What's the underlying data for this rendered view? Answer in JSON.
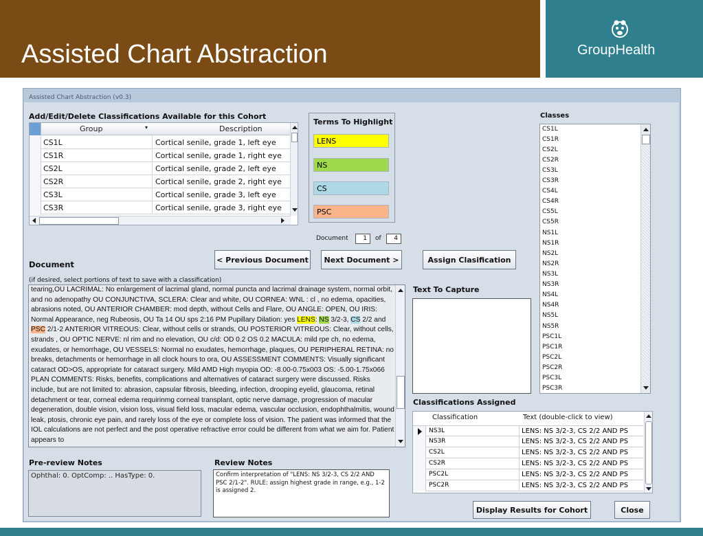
{
  "slide": {
    "title": "Assisted Chart Abstraction",
    "brand": "GroupHealth",
    "colors": {
      "banner": "#7b4b16",
      "brand": "#2f7f8e"
    }
  },
  "window": {
    "title": "Assisted Chart Abstraction (v0.3)"
  },
  "classifications_panel": {
    "heading": "Add/Edit/Delete Classifications Available for this Cohort",
    "columns": [
      "Group",
      "Description"
    ],
    "rows": [
      {
        "group": "CS1L",
        "description": "Cortical senile, grade 1, left eye"
      },
      {
        "group": "CS1R",
        "description": "Cortical senile, grade 1, right eye"
      },
      {
        "group": "CS2L",
        "description": "Cortical senile, grade 2, left eye"
      },
      {
        "group": "CS2R",
        "description": "Cortical senile, grade 2, right eye"
      },
      {
        "group": "CS3L",
        "description": "Cortical senile, grade 3, left eye"
      },
      {
        "group": "CS3R",
        "description": "Cortical senile, grade 3, right eye"
      }
    ]
  },
  "terms": {
    "heading": "Terms To Highlight",
    "items": [
      {
        "label": "LENS",
        "color": "#ffff00"
      },
      {
        "label": "NS",
        "color": "#a1d94c"
      },
      {
        "label": "CS",
        "color": "#add8e6"
      },
      {
        "label": "PSC",
        "color": "#f9b48a"
      }
    ]
  },
  "document_nav": {
    "label": "Document",
    "current": "1",
    "of_label": "of",
    "total": "4",
    "prev_button": "< Previous Document",
    "next_button": "Next Document >",
    "assign_button": "Assign Clasification"
  },
  "document": {
    "heading": "Document",
    "hint": "(if desired, select portions of text to save with a classification)",
    "text": {
      "p1": "tearing,OU  LACRIMAL: No enlargement of lacrimal gland, normal puncta and lacrimal drainage system, normal orbit, and no adenopathy OU  CONJUNCTIVA, SCLERA: Clear and white, OU  CORNEA: WNL : cl , no edema, opacities, abrasions noted, OU  ANTERIOR CHAMBER: mod depth, without Cells and Flare, OU  ANGLE: OPEN, OU  IRIS: Normal Appearance, neg Rubeosis, OU   Ta 14 OU sps 2:16 PM Pupillary Dilation: yes    ",
      "lens": "LENS",
      "p2": ": ",
      "ns": "NS",
      "p3": " 3/2-3, ",
      "cs": "CS",
      "p4": " 2/2 and ",
      "psc": "PSC",
      "p5": " 2/1-2    ANTERIOR VITREOUS: Clear, without cells or strands, OU  POSTERIOR VITREOUS: Clear, without cells, strands , OU    OPTIC NERVE: nl rim and no elevation, OU    c/d: OD 0.2   OS 0.2    MACULA: mild rpe ch, no edema, exudates, or hemorrhage, OU  VESSELS: Normal no exudates, hemorrhage, plaques, OU  PERIPHERAL RETINA: no breaks, detachments or hemorrhage in all clock hours to ora, OU  ASSESSMENT COMMENTS:  Visually significant cataract OD>OS, appropriate for cataract surgery. Mild AMD    High myopia  OD: -8.00-0.75x003  OS: -5.00-1.75x066    PLAN COMMENTS:  Risks, benefits, complications and alternatives of cataract surgery were discussed. Risks include, but are not limited to: abrasion, capsular fibrosis, bleeding, infection, drooping eyelid, glaucoma, retinal detachment or tear, corneal edema requirinmg corneal transplant, optic nerve damage, progression of macular degeneration, double vision, vision loss, visual field loss, macular edema, vascular occlusion, endophthalmitis, wound leak, ptosis, chronic eye pain, and rarely loss of the eye or complete loss of vision.    The patient was informed that the IOL calculations are not perfect and the post operative refractive error could be different from what we aim for.    Patient appears to"
    }
  },
  "classes": {
    "heading": "Classes",
    "items": [
      "CS1L",
      "CS1R",
      "CS2L",
      "CS2R",
      "CS3L",
      "CS3R",
      "CS4L",
      "CS4R",
      "CS5L",
      "CS5R",
      "NS1L",
      "NS1R",
      "NS2L",
      "NS2R",
      "NS3L",
      "NS3R",
      "NS4L",
      "NS4R",
      "NS5L",
      "NS5R",
      "PSC1L",
      "PSC1R",
      "PSC2L",
      "PSC2R",
      "PSC3L",
      "PSC3R"
    ]
  },
  "text_to_capture": {
    "heading": "Text To Capture",
    "value": ""
  },
  "assigned": {
    "heading": "Classifications Assigned",
    "columns": [
      "Classification",
      "Text (double-click to view)"
    ],
    "rows": [
      {
        "classification": "NS3L",
        "text": "LENS: NS 3/2-3, CS 2/2 AND PS"
      },
      {
        "classification": "NS3R",
        "text": "LENS: NS 3/2-3, CS 2/2 AND PS"
      },
      {
        "classification": "CS2L",
        "text": "LENS: NS 3/2-3, CS 2/2 AND PS"
      },
      {
        "classification": "CS2R",
        "text": "LENS: NS 3/2-3, CS 2/2 AND PS"
      },
      {
        "classification": "PSC2L",
        "text": "LENS: NS 3/2-3, CS 2/2 AND PS"
      },
      {
        "classification": "PSC2R",
        "text": "LENS: NS 3/2-3, CS 2/2 AND PS"
      }
    ]
  },
  "buttons": {
    "display_results": "Display Results for Cohort",
    "close": "Close"
  },
  "notes": {
    "preview_heading": "Pre-review Notes",
    "preview_text": "Ophthal: 0.  OptComp: ..  HasType: 0.",
    "review_heading": "Review Notes",
    "review_text": "Confirm interpretation of \"LENS: NS 3/2-3, CS 2/2 AND PSC 2/1-2\".  RULE: assign highest grade in range, e.g., 1-2 is assigned 2."
  }
}
